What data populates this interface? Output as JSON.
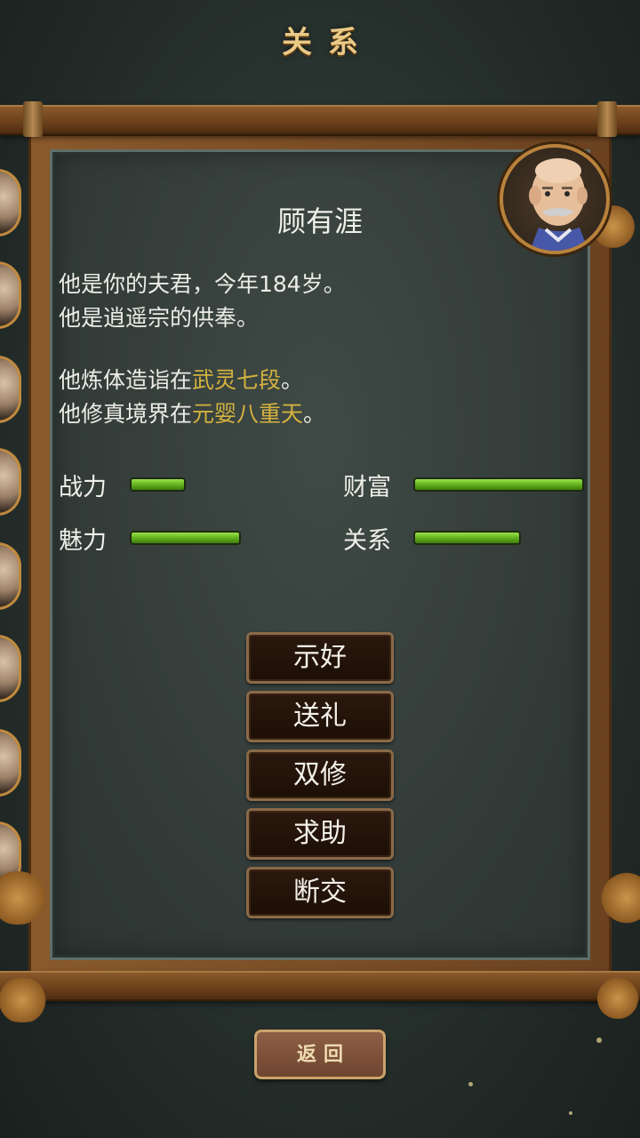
{
  "header": {
    "title": "关系"
  },
  "character": {
    "name": "顾有涯",
    "desc_line1": "他是你的夫君，今年184岁。",
    "desc_line2": "他是逍遥宗的供奉。",
    "body_prefix": "他炼体造诣在",
    "body_level": "武灵七段",
    "body_suffix": "。",
    "cult_prefix": "他修真境界在",
    "cult_level": "元婴八重天",
    "cult_suffix": "。"
  },
  "stats": [
    {
      "label": "战力",
      "value": 0.33
    },
    {
      "label": "财富",
      "value": 1.0
    },
    {
      "label": "魅力",
      "value": 0.65
    },
    {
      "label": "关系",
      "value": 0.63
    }
  ],
  "actions": [
    "示好",
    "送礼",
    "双修",
    "求助",
    "断交"
  ],
  "back_label": "返回",
  "colors": {
    "highlight": "#d4b23e",
    "bar_green": "#7cc531",
    "title_gold": "#e9c985"
  }
}
